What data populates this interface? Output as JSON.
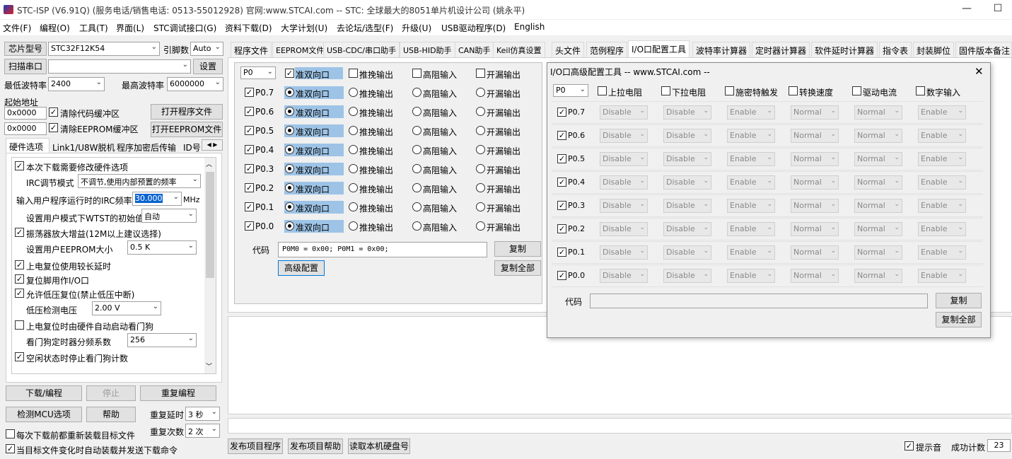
{
  "title_bar": {
    "text": "STC-ISP (V6.91Q) (服务电话/销售电话: 0513-55012928) 官网:www.STCAI.com  -- STC: 全球最大的8051单片机设计公司 (姚永平)",
    "minimize": "—",
    "maximize": "☐"
  },
  "menu": [
    "文件(F)",
    "编程(O)",
    "工具(T)",
    "界面(L)",
    "STC调试接口(G)",
    "资料下载(D)",
    "大学计划(U)",
    "去论坛/选型(F)",
    "升级(U)",
    "USB驱动程序(D)",
    "English"
  ],
  "left": {
    "chip_label": "芯片型号",
    "chip_value": "STC32F12K54",
    "pin_label": "引脚数",
    "pin_value": "Auto",
    "scan_btn": "扫描串口",
    "port_value": "",
    "settings_btn": "设置",
    "min_baud_label": "最低波特率",
    "min_baud": "2400",
    "max_baud_label": "最高波特率",
    "max_baud": "6000000",
    "start_addr_label": "起始地址",
    "addr1": "0x0000",
    "clear_code": "清除代码缓冲区",
    "open_prog_btn": "打开程序文件",
    "addr2": "0x0000",
    "clear_eeprom": "清除EEPROM缓冲区",
    "open_eeprom_btn": "打开EEPROM文件",
    "tabs": [
      "硬件选项",
      "Link1/U8W脱机",
      "程序加密后传输",
      "ID号"
    ],
    "options": {
      "modify_hw": "本次下载需要修改硬件选项",
      "irc_mode_label": "IRC调节模式",
      "irc_mode": "不调节,使用内部预置的频率",
      "irc_freq_label": "输入用户程序运行时的IRC频率",
      "irc_freq": "30.000",
      "mhz": "MHz",
      "wtst_label": "设置用户模式下WTST的初始值",
      "wtst": "自动",
      "osc_gain": "振荡器放大增益(12M以上建议选择)",
      "eeprom_size_label": "设置用户EEPROM大小",
      "eeprom_size": "0.5 K",
      "power_delay": "上电复位使用较长延时",
      "reset_io": "复位脚用作I/O口",
      "lvr": "允许低压复位(禁止低压中断)",
      "lvd_label": "低压检测电压",
      "lvd": "2.00 V",
      "wdt_auto": "上电复位时由硬件自动启动看门狗",
      "wdt_div_label": "看门狗定时器分频系数",
      "wdt_div": "256",
      "idle_wdt": "空闲状态时停止看门狗计数"
    },
    "download_btn": "下载/编程",
    "stop_btn": "停止",
    "reprogram_btn": "重复编程",
    "check_mcu_btn": "检测MCU选项",
    "help_btn": "帮助",
    "repeat_delay_label": "重复延时",
    "repeat_delay": "3 秒",
    "reload_before": "每次下载前都重新装载目标文件",
    "repeat_count_label": "重复次数",
    "repeat_count": "2 次",
    "auto_load": "当目标文件变化时自动装载并发送下载命令"
  },
  "tabs": [
    "程序文件",
    "EEPROM文件",
    "USB-CDC/串口助手",
    "USB-HID助手",
    "CAN助手",
    "Keil仿真设置",
    "头文件",
    "范例程序",
    "I/O口配置工具",
    "波特率计算器",
    "定时器计算器",
    "软件延时计算器",
    "指令表",
    "封装脚位",
    "固件版本备注"
  ],
  "io": {
    "port": "P0",
    "modes": [
      "准双向口",
      "推挽输出",
      "高阻输入",
      "开漏输出"
    ],
    "pins": [
      "P0.7",
      "P0.6",
      "P0.5",
      "P0.4",
      "P0.3",
      "P0.2",
      "P0.1",
      "P0.0"
    ],
    "code_label": "代码",
    "code": "P0M0 = 0x00; P0M1 = 0x00;",
    "copy_btn": "复制",
    "advanced_btn": "高级配置",
    "copy_all_btn": "复制全部"
  },
  "adv": {
    "title": "I/O口高级配置工具 -- www.STCAI.com --",
    "close": "✕",
    "port": "P0",
    "headers": [
      "上拉电阻",
      "下拉电阻",
      "施密特触发",
      "转换速度",
      "驱动电流",
      "数字输入"
    ],
    "pins": [
      "P0.7",
      "P0.6",
      "P0.5",
      "P0.4",
      "P0.3",
      "P0.2",
      "P0.1",
      "P0.0"
    ],
    "values": [
      "Disable",
      "Disable",
      "Enable",
      "Normal",
      "Normal",
      "Enable"
    ],
    "code_label": "代码",
    "code": "",
    "copy_btn": "复制",
    "copy_all_btn": "复制全部"
  },
  "bottom": {
    "publish_btn": "发布项目程序",
    "publish_help_btn": "发布项目帮助",
    "read_disk_btn": "读取本机硬盘号",
    "sound_label": "提示音",
    "count_label": "成功计数",
    "count": "23"
  }
}
